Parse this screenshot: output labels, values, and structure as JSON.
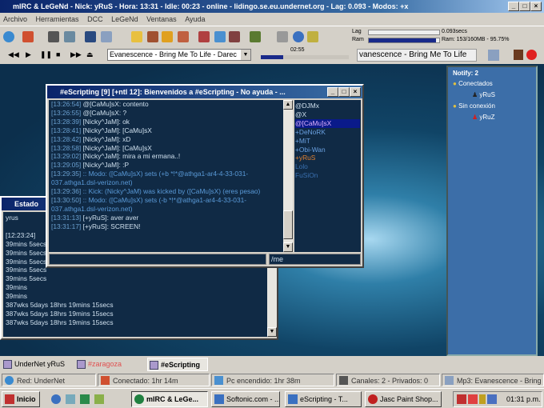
{
  "app": {
    "title": "mIRC & LeGeNd - Nick: yRuS - Hora: 13:31 - Idle: 00:23 - online - lidingo.se.eu.undernet.org - Lag: 0.093 - Modos: +x"
  },
  "menu": [
    "Archivo",
    "Herramientas",
    "DCC",
    "LeGeNd",
    "Ventanas",
    "Ayuda"
  ],
  "meters": {
    "lag_label": "Lag",
    "lag_value": "0.093secs",
    "ram_label": "Ram",
    "ram_value": "Ram: 153/160MB - 95.75%",
    "ram_percent": 95.75
  },
  "media": {
    "song_select": "Evanescence - Bring Me To Life - Darec",
    "time": "02:55",
    "progress_percent": 25,
    "ticker": "vanescence - Bring Me To Life"
  },
  "channel": {
    "title": "#eScripting [9] [+ntl 12]: Bienvenidos a #eScripting - No ayuda - ...",
    "lines": [
      {
        "ts": "[13:26:54]",
        "text": "@[CaMu]sX: contento"
      },
      {
        "ts": "[13:26:55]",
        "text": "@[CaMu]sX: ?"
      },
      {
        "ts": "[13:28:39]",
        "text": "[Nicky^JaM]: ok"
      },
      {
        "ts": "[13:28:41]",
        "text": "[Nicky^JaM]: [CaMu]sX"
      },
      {
        "ts": "[13:28:42]",
        "text": "[Nicky^JaM]: xD"
      },
      {
        "ts": "[13:28:58]",
        "text": "[Nicky^JaM]: [CaMu]sX"
      },
      {
        "ts": "[13:29:02]",
        "text": "[Nicky^JaM]: mira a mi ermana..!"
      },
      {
        "ts": "[13:29:05]",
        "text": "[Nicky^JaM]: :P"
      },
      {
        "ts": "[13:29:35]",
        "text": ":: Modo: ([CaMu]sX) sets (+b *!*@athga1-ar4-4-33-031-037.athga1.dsl-verizon.net)"
      },
      {
        "ts": "[13:29:36]",
        "text": ":: Kick: (Nicky^JaM) was kicked by ([CaMu]sX) (eres pesao)"
      },
      {
        "ts": "[13:30:50]",
        "text": ":: Modo: ([CaMu]sX) sets (-b *!*@athga1-ar4-4-33-031-037.athga1.dsl-verizon.net)"
      },
      {
        "ts": "[13:31:13]",
        "text": "[+yRuS]: aver aver"
      },
      {
        "ts": "[13:31:17]",
        "text": "[+yRuS]: SCREEN!"
      }
    ],
    "nicks": [
      "@DJMx",
      "@X",
      "@[CaMu]sX",
      "+DeNoRK",
      "+MiT",
      "+Obi-Wan",
      "+yRuS",
      "Lolo",
      "FuSiOn"
    ],
    "input": "",
    "input_right": "/me"
  },
  "status": {
    "title": "Estado",
    "lines": [
      "yrus",
      "",
      "[12:23:24]",
      "39mins 5secs",
      "39mins 5secs",
      "39mins 5secs",
      "39mins 5secs",
      "39mins 5secs",
      "39mins",
      "39mins",
      "387wks 5days 18hrs 19mins 15secs",
      "387wks 5days 18hrs 19mins 15secs",
      "387wks 5days 18hrs 19mins 15secs"
    ]
  },
  "notify": {
    "title": "Notify: 2",
    "groups": [
      {
        "label": "Conectados",
        "users": [
          "yRuS"
        ]
      },
      {
        "label": "Sin conexión",
        "users": [
          "yRuZ"
        ]
      }
    ]
  },
  "switchbar": [
    "UnderNet yRuS",
    "#zaragoza",
    "#eScripting"
  ],
  "statusbar": [
    "Red: UnderNet",
    "Conectado: 1hr 14m",
    "Pc encendido: 1hr 38m",
    "Canales: 2 - Privados: 0",
    "Mp3: Evanescence - Bring"
  ],
  "taskbar": {
    "start": "Inicio",
    "tasks": [
      "mIRC & LeGe...",
      "Softonic.com - ...",
      "eScripting - T...",
      "Jasc Paint Shop..."
    ],
    "clock": "01:31 p.m."
  },
  "colors": {
    "title": "#0a246a",
    "chat_bg": "#102a45",
    "notify_bg": "#3c6ea8"
  }
}
